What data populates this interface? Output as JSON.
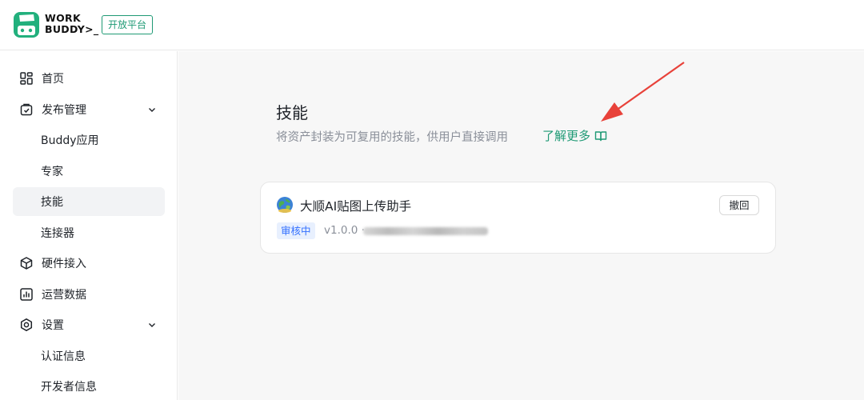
{
  "header": {
    "brand_line1": "WORK",
    "brand_line2": "BUDDY>_",
    "platform_badge": "开放平台"
  },
  "sidebar": {
    "items": [
      {
        "label": "首页",
        "icon": "home-grid-icon"
      },
      {
        "label": "发布管理",
        "icon": "publish-icon",
        "expanded": true
      },
      {
        "label": "Buddy应用"
      },
      {
        "label": "专家"
      },
      {
        "label": "技能",
        "active": true
      },
      {
        "label": "连接器"
      },
      {
        "label": "硬件接入",
        "icon": "cube-icon"
      },
      {
        "label": "运营数据",
        "icon": "chart-icon"
      },
      {
        "label": "设置",
        "icon": "settings-icon",
        "expanded": true
      },
      {
        "label": "认证信息"
      },
      {
        "label": "开发者信息"
      }
    ]
  },
  "main": {
    "title": "技能",
    "description": "将资产封装为可复用的技能，供用户直接调用",
    "learn_more": "了解更多",
    "skills": [
      {
        "name": "大顺AI贴图上传助手",
        "status": "审核中",
        "version": "v1.0.0 ·",
        "action": "撤回"
      }
    ]
  },
  "colors": {
    "accent": "#1f9a75",
    "status_blue": "#3370ff",
    "annotation_arrow": "#e8423a"
  }
}
